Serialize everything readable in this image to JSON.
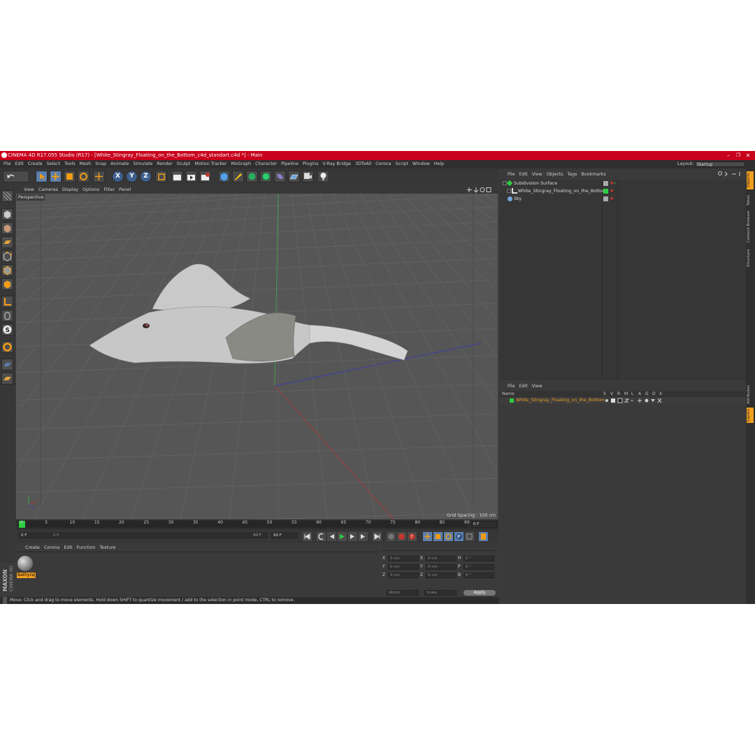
{
  "window": {
    "title": "CINEMA 4D R17.055 Studio (R17) - [White_Stingray_Floating_on_the_Bottom_c4d_standart.c4d *] - Main",
    "controls": [
      "–",
      "❐",
      "✕"
    ]
  },
  "menu": [
    "File",
    "Edit",
    "Create",
    "Select",
    "Tools",
    "Mesh",
    "Snap",
    "Animate",
    "Simulate",
    "Render",
    "Sculpt",
    "Motion Tracker",
    "MoGraph",
    "Character",
    "Pipeline",
    "Plugins",
    "V-Ray Bridge",
    "3DToAll",
    "Corona",
    "Script",
    "Window",
    "Help"
  ],
  "layout": {
    "label": "Layout:",
    "value": "Startup"
  },
  "toolbar": {
    "axis_x": "X",
    "axis_y": "Y",
    "axis_z": "Z"
  },
  "viewport": {
    "menu": [
      "View",
      "Cameras",
      "Display",
      "Options",
      "Filter",
      "Panel"
    ],
    "camera_label": "Perspective",
    "grid_spacing": "Grid Spacing : 100 cm"
  },
  "timeline": {
    "ticks": [
      "0",
      "5",
      "10",
      "15",
      "20",
      "25",
      "30",
      "35",
      "40",
      "45",
      "50",
      "55",
      "60",
      "65",
      "70",
      "75",
      "80",
      "85",
      "90"
    ],
    "current_frame_field": "0 F",
    "start_field": "0 F",
    "slider_start": "0 F",
    "slider_end": "90 F",
    "end_field": "90 F"
  },
  "material_manager": {
    "menu": [
      "Create",
      "Corona",
      "Edit",
      "Function",
      "Texture"
    ],
    "materials": [
      {
        "name": "Bathyraj"
      }
    ]
  },
  "coordinates": {
    "rows": [
      {
        "a": "X",
        "a_val": "0 cm",
        "b": "X",
        "b_val": "0 cm",
        "c": "H",
        "c_val": "0 °"
      },
      {
        "a": "Y",
        "a_val": "0 cm",
        "b": "Y",
        "b_val": "0 cm",
        "c": "P",
        "c_val": "0 °"
      },
      {
        "a": "Z",
        "a_val": "0 cm",
        "b": "Z",
        "b_val": "0 cm",
        "c": "B",
        "c_val": "0 °"
      }
    ],
    "mode1": "World",
    "mode2": "Scale",
    "apply": "Apply"
  },
  "object_manager": {
    "menu": [
      "File",
      "Edit",
      "View",
      "Objects",
      "Tags",
      "Bookmarks"
    ],
    "objects": [
      {
        "name": "Subdivision Surface",
        "level": 0
      },
      {
        "name": "White_Stingray_Floating_on_the_Bottom",
        "level": 1
      },
      {
        "name": "Sky",
        "level": 0
      }
    ]
  },
  "layer_manager": {
    "menu": [
      "File",
      "Edit",
      "View"
    ],
    "name_header": "Name",
    "columns": [
      "S",
      "V",
      "R",
      "M",
      "L",
      "A",
      "G",
      "D",
      "X"
    ],
    "layers": [
      {
        "name": "White_Stingray_Floating_on_the_Bottom",
        "color": "#2ecc40"
      }
    ]
  },
  "right_tabs": [
    "Objects",
    "Takes",
    "Content Browser",
    "Structure"
  ],
  "right_tabs_lower": [
    "Attributes",
    "Layers"
  ],
  "brand": {
    "line1": "MAXON",
    "line2": "CINEMA 4D"
  },
  "status": "Move: Click and drag to move elements. Hold down SHIFT to quantize movement / add to the selection in point mode, CTRL to remove.",
  "colors": {
    "titlebar": "#c8001c",
    "accent_orange": "#f0a020",
    "selection_blue": "#5a7fae"
  }
}
